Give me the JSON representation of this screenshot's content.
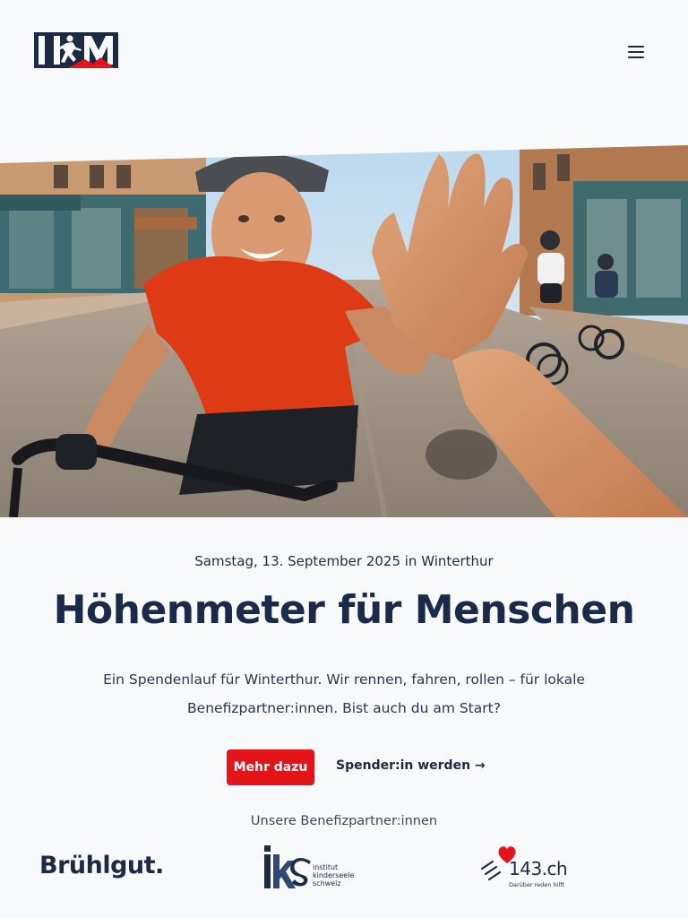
{
  "brand": {
    "logo_icon": "hfm-runner-logo",
    "logo_text": "HFM",
    "colors": {
      "navy": "#1c2a44",
      "accent": "#e3141a",
      "background": "#f8f9fb"
    }
  },
  "header": {
    "menu_icon": "hamburger-menu-icon"
  },
  "hero": {
    "image": "photo: smiling senior woman cyclist in red jersey giving a high five, other cyclists riding on a town street"
  },
  "event": {
    "date_line": "Samstag, 13. September 2025 in Winterthur",
    "title": "Höhenmeter für Menschen",
    "intro": "Ein Spendenlauf für Winterthur. Wir rennen, fahren, rollen – für lokale Benefizpartner:innen. Bist auch du am Start?"
  },
  "actions": {
    "primary_label": "Mehr dazu",
    "secondary_label": "Spender:in werden →"
  },
  "partners": {
    "heading": "Unsere Benefizpartner:innen",
    "items": [
      {
        "name": "Brühlgut.",
        "icon": "bruehlgut-logo"
      },
      {
        "name": "ikS",
        "line1": "institut",
        "line2": "kinderseele",
        "line3": "schweiz",
        "icon": "iks-logo"
      },
      {
        "name": "143.ch",
        "tagline": "Darüber reden hilft",
        "icon": "heart-icon"
      }
    ]
  }
}
